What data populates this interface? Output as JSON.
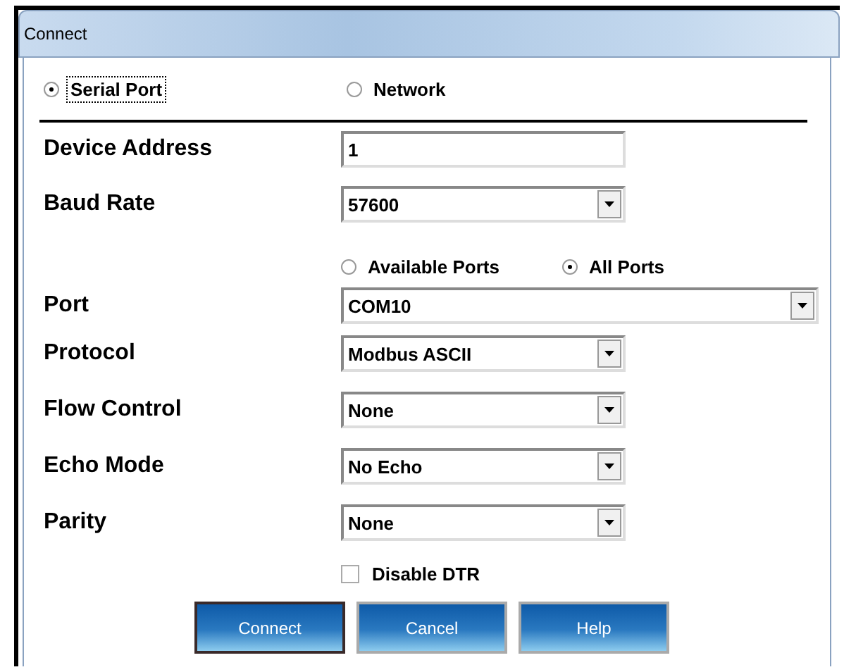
{
  "window": {
    "title": "Connect"
  },
  "connection_types": [
    {
      "label": "Serial Port",
      "selected": true,
      "focused": true
    },
    {
      "label": "Network",
      "selected": false,
      "focused": false
    }
  ],
  "rows": [
    {
      "kind": "text",
      "label": "Device Address",
      "value": "1"
    },
    {
      "kind": "select",
      "label": "Baud Rate",
      "value": "57600"
    },
    {
      "kind": "radios",
      "options": [
        {
          "label": "Available Ports",
          "selected": false
        },
        {
          "label": "All Ports",
          "selected": true
        }
      ]
    },
    {
      "kind": "wide-select",
      "label": "Port",
      "value": "COM10"
    },
    {
      "kind": "select",
      "label": "Protocol",
      "value": "Modbus ASCII"
    },
    {
      "kind": "select",
      "label": "Flow Control",
      "value": "None"
    },
    {
      "kind": "select",
      "label": "Echo Mode",
      "value": "No Echo"
    },
    {
      "kind": "select",
      "label": "Parity",
      "value": "None"
    },
    {
      "kind": "checkbox",
      "label": "Disable DTR",
      "checked": false
    }
  ],
  "buttons": [
    {
      "label": "Connect",
      "default": true
    },
    {
      "label": "Cancel",
      "default": false
    },
    {
      "label": "Help",
      "default": false
    }
  ]
}
